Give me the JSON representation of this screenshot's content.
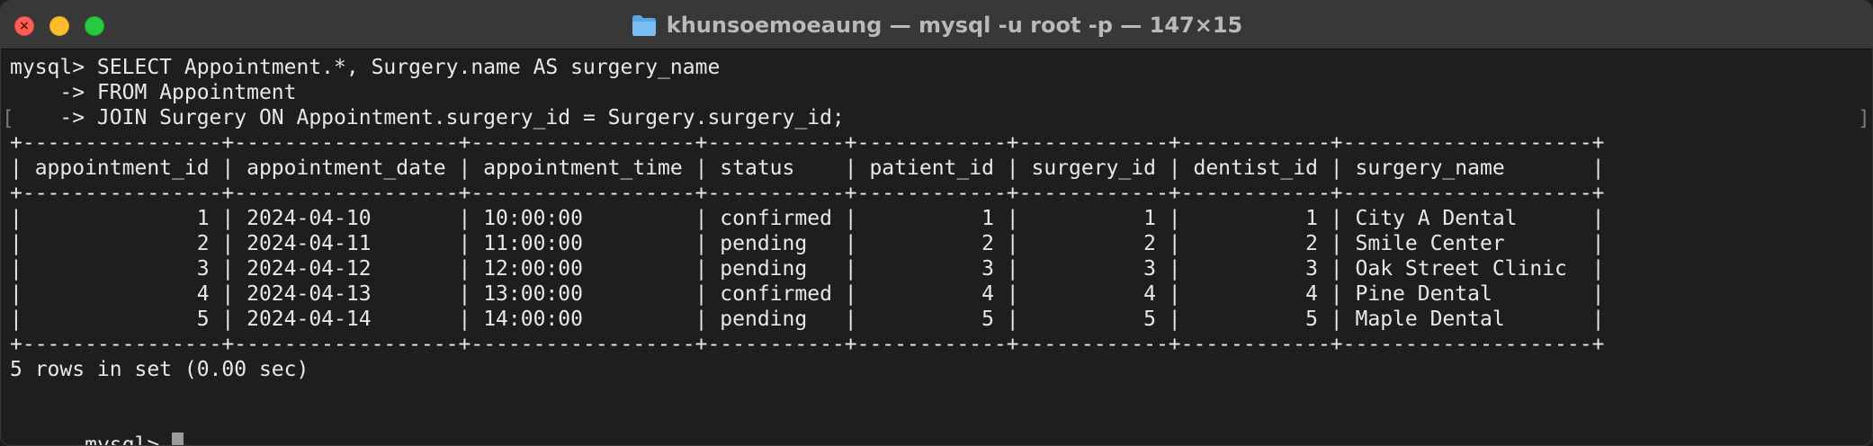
{
  "window": {
    "title": "khunsoemoeaung — mysql -u root -p — 147×15",
    "controls": {
      "close_glyph": "×"
    }
  },
  "colors": {
    "background": "#1e1e1e",
    "titlebar": "#383838",
    "text": "#e8e8e8",
    "close": "#fe5f57",
    "minimize": "#febc2e",
    "maximize": "#28c840"
  },
  "terminal": {
    "lines": [
      "mysql> SELECT Appointment.*, Surgery.name AS surgery_name",
      "    -> FROM Appointment",
      "    -> JOIN Surgery ON Appointment.surgery_id = Surgery.surgery_id;",
      "+----------------+------------------+------------------+-----------+------------+------------+------------+--------------------+",
      "| appointment_id | appointment_date | appointment_time | status    | patient_id | surgery_id | dentist_id | surgery_name       |",
      "+----------------+------------------+------------------+-----------+------------+------------+------------+--------------------+",
      "|              1 | 2024-04-10       | 10:00:00         | confirmed |          1 |          1 |          1 | City A Dental      |",
      "|              2 | 2024-04-11       | 11:00:00         | pending   |          2 |          2 |          2 | Smile Center       |",
      "|              3 | 2024-04-12       | 12:00:00         | pending   |          3 |          3 |          3 | Oak Street Clinic  |",
      "|              4 | 2024-04-13       | 13:00:00         | confirmed |          4 |          4 |          4 | Pine Dental        |",
      "|              5 | 2024-04-14       | 14:00:00         | pending   |          5 |          5 |          5 | Maple Dental       |",
      "+----------------+------------------+------------------+-----------+------------+------------+------------+--------------------+",
      "5 rows in set (0.00 sec)",
      ""
    ],
    "prompt": "mysql> ",
    "bracket_left": "[",
    "bracket_right": "]"
  }
}
